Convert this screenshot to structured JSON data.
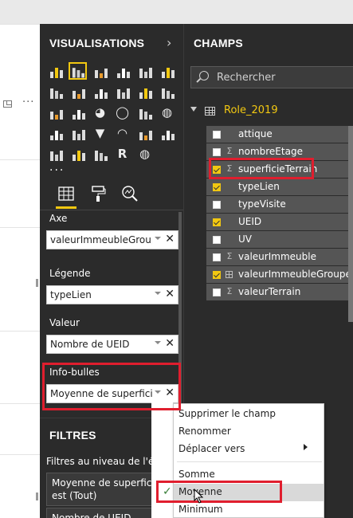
{
  "visualisations": {
    "title": "VISUALISATIONS",
    "icons": [
      "stacked-bar-icon",
      "stacked-column-icon",
      "clustered-bar-icon",
      "clustered-column-icon",
      "100-bar-icon",
      "100-column-icon",
      "line-icon",
      "area-icon",
      "stacked-area-icon",
      "line-column-icon",
      "line-clustered-icon",
      "ribbon-icon",
      "waterfall-icon",
      "scatter-icon",
      "pie-icon",
      "donut-icon",
      "treemap-icon",
      "map-icon",
      "filled-map-icon",
      "shape-map-icon",
      "funnel-icon",
      "gauge-icon",
      "card-icon",
      "kpi-icon",
      "slicer-icon",
      "table-icon",
      "matrix-icon",
      "r-visual-icon",
      "globe-icon"
    ],
    "selected_icon": "stacked-column-icon",
    "more": "...",
    "wells": [
      {
        "label": "Axe",
        "value": "valeurImmeubleGroupe"
      },
      {
        "label": "Légende",
        "value": "typeLien"
      },
      {
        "label": "Valeur",
        "value": "Nombre de UEID"
      },
      {
        "label": "Info-bulles",
        "value": "Moyenne de superficieT"
      }
    ],
    "filters_title": "FILTRES",
    "filters_level": "Filtres au niveau de l'élé",
    "filter_card_1_line1": "Moyenne de superficie",
    "filter_card_1_line2": "est (Tout)",
    "filter_card_2": "Nombre de UEID"
  },
  "champs": {
    "title": "CHAMPS",
    "search_placeholder": "Rechercher",
    "table_name": "Role_2019",
    "fields": [
      {
        "name": "attique",
        "checked": false,
        "type": ""
      },
      {
        "name": "nombreEtage",
        "checked": false,
        "type": "Σ"
      },
      {
        "name": "superficieTerrain",
        "checked": true,
        "type": "Σ"
      },
      {
        "name": "typeLien",
        "checked": true,
        "type": ""
      },
      {
        "name": "typeVisite",
        "checked": false,
        "type": ""
      },
      {
        "name": "UEID",
        "checked": true,
        "type": ""
      },
      {
        "name": "UV",
        "checked": false,
        "type": ""
      },
      {
        "name": "valeurImmeuble",
        "checked": false,
        "type": "Σ"
      },
      {
        "name": "valeurImmeubleGroupe",
        "checked": true,
        "type": "grid"
      },
      {
        "name": "valeurTerrain",
        "checked": false,
        "type": "Σ"
      }
    ]
  },
  "context_menu": {
    "items": [
      {
        "label": "Supprimer le champ"
      },
      {
        "label": "Renommer"
      },
      {
        "label": "Déplacer vers",
        "submenu": true
      },
      {
        "label": "Somme"
      },
      {
        "label": "Moyenne",
        "checked": true
      },
      {
        "label": "Minimum"
      }
    ]
  },
  "colors": {
    "accent": "#f2c811",
    "highlight": "#e01e2e",
    "pane_bg": "#2b2b2b",
    "field_row_bg": "#555555"
  }
}
